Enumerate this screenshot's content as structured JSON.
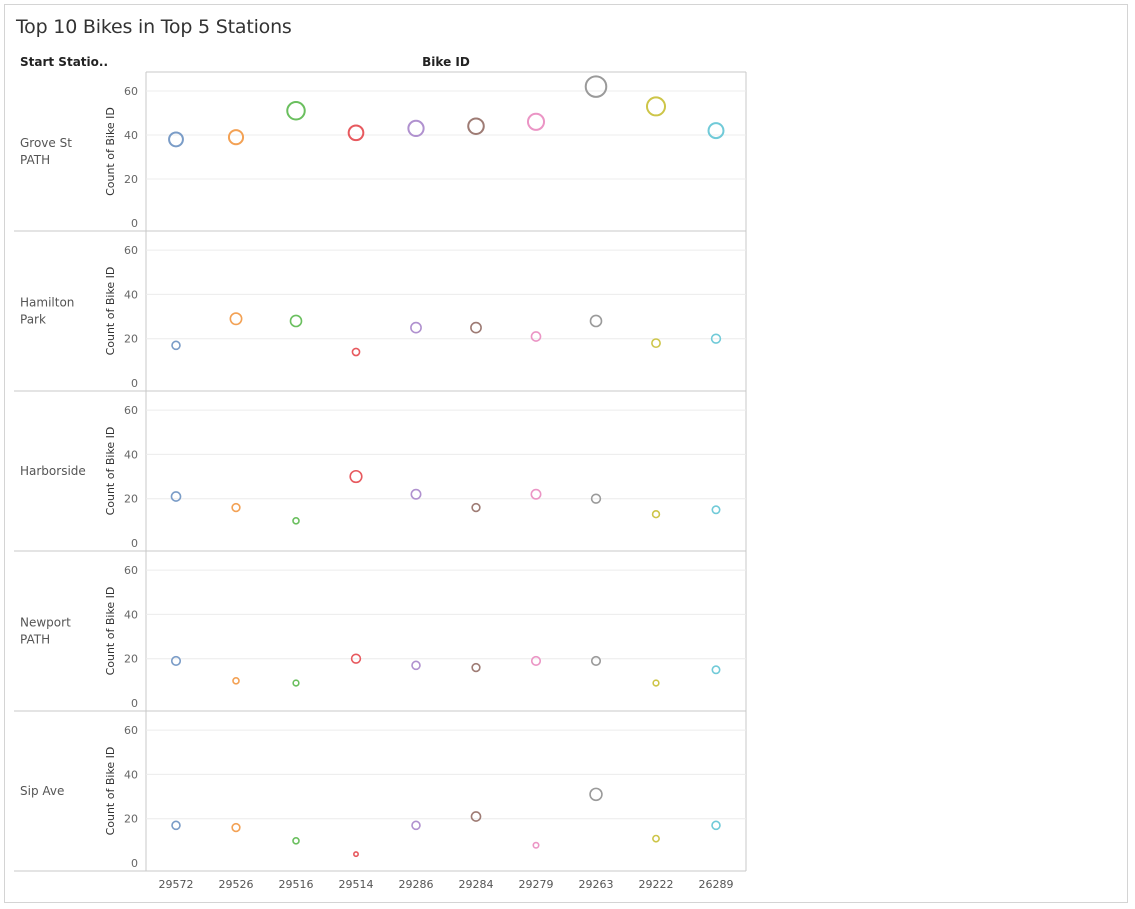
{
  "chart_data": {
    "type": "scatter",
    "title": "Top 10 Bikes in Top 5 Stations",
    "row_header": "Start Statio..",
    "column_header": "Bike ID",
    "ylabel": "Count of Bike ID",
    "ylim": [
      0,
      65
    ],
    "yticks": [
      0,
      20,
      40,
      60
    ],
    "grid": true,
    "size_encodes": "Count of Bike ID",
    "color_encodes": "Bike ID",
    "categories": [
      "29572",
      "29526",
      "29516",
      "29514",
      "29286",
      "29284",
      "29279",
      "29263",
      "29222",
      "26289"
    ],
    "colors": [
      "#7a9cc7",
      "#f3a154",
      "#6abf5e",
      "#e7595e",
      "#b091cf",
      "#9e7b74",
      "#eb95c5",
      "#9a9a9a",
      "#cdc548",
      "#70cad8"
    ],
    "series": [
      {
        "station": "Grove St PATH",
        "values": [
          38,
          39,
          51,
          41,
          43,
          44,
          46,
          62,
          53,
          42
        ]
      },
      {
        "station": "Hamilton Park",
        "values": [
          17,
          29,
          28,
          14,
          25,
          25,
          21,
          28,
          18,
          20
        ]
      },
      {
        "station": "Harborside",
        "values": [
          21,
          16,
          10,
          30,
          22,
          16,
          22,
          20,
          13,
          15
        ]
      },
      {
        "station": "Newport PATH",
        "values": [
          19,
          10,
          9,
          20,
          17,
          16,
          19,
          19,
          9,
          15
        ]
      },
      {
        "station": "Sip Ave",
        "values": [
          17,
          16,
          10,
          4,
          17,
          21,
          8,
          31,
          11,
          17
        ]
      }
    ]
  }
}
